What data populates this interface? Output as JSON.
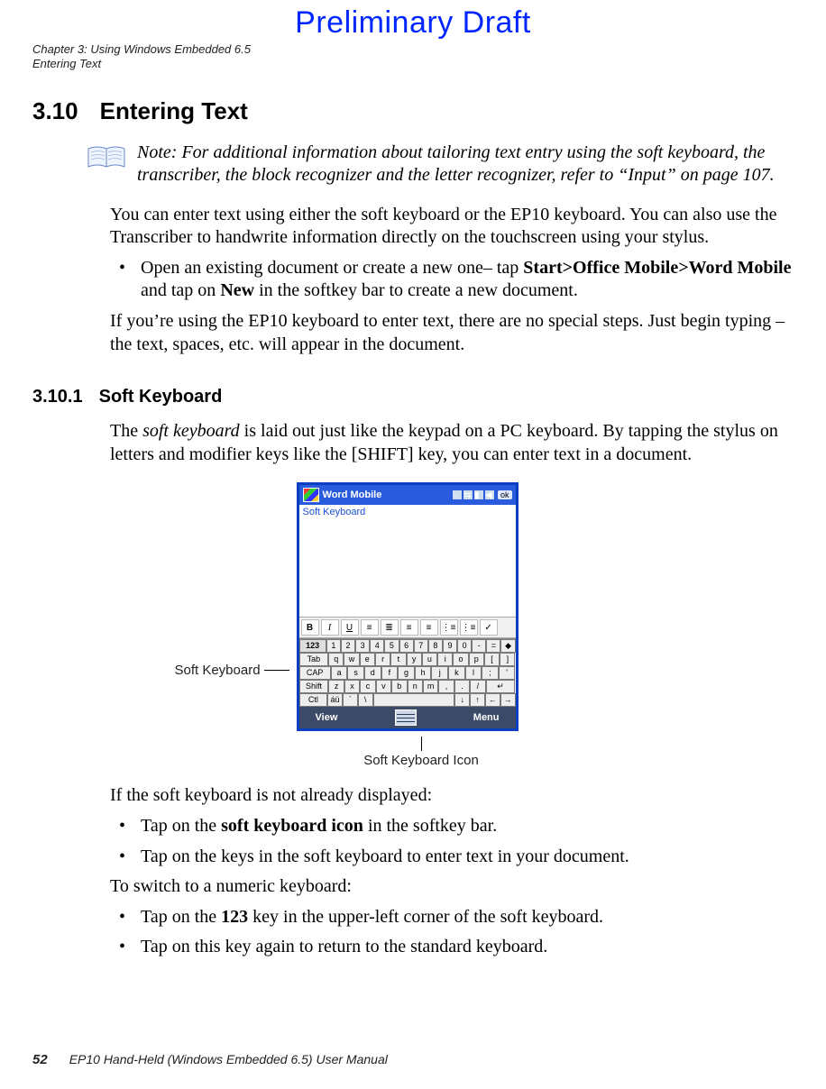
{
  "watermark": "Preliminary Draft",
  "runhead": {
    "l1": "Chapter 3: Using Windows Embedded 6.5",
    "l2": "Entering Text"
  },
  "section": {
    "num": "3.10",
    "title": "Entering Text"
  },
  "note": {
    "label": "Note:",
    "text": "For additional information about tailoring text entry using the soft keyboard, the transcriber, the block recognizer and the letter recognizer, refer to “Input” on page 107."
  },
  "p_intro": "You can enter text using either the soft keyboard or the EP10 keyboard. You can also use the Transcriber to handwrite information directly on the touchscreen using your stylus.",
  "li_open": {
    "pre": "Open an existing document or create a new one– tap ",
    "b1": "Start>Office Mobile>Word Mobile",
    "mid": " and tap on ",
    "b2": "New",
    "post": " in the softkey bar to create a new document."
  },
  "p_after": "If you’re using the EP10 keyboard to enter text, there are no special steps. Just begin typing – the text, spaces, etc. will appear in the document.",
  "subsection": {
    "num": "3.10.1",
    "title": "Soft Keyboard"
  },
  "p_soft": {
    "pre": "The ",
    "ital": "soft keyboard",
    "post": " is laid out just like the keypad on a PC keyboard. By tapping the stylus on letters and modifier keys like the [SHIFT] key, you can enter text in a document."
  },
  "callouts": {
    "left": "Soft Keyboard",
    "bottom": "Soft Keyboard Icon"
  },
  "p_notdisplayed": "If the soft keyboard is not already displayed:",
  "li_icon": {
    "pre": "Tap on the ",
    "b": "soft keyboard icon",
    "post": " in the softkey bar."
  },
  "li_type": "Tap on the keys in the soft keyboard to enter text in your document.",
  "p_switch": "To switch to a numeric keyboard:",
  "li_123": {
    "pre": "Tap on the ",
    "b": "123",
    "post": " key in the upper-left corner of the soft keyboard."
  },
  "li_return": "Tap on this key again to return to the standard keyboard.",
  "footer": {
    "page": "52",
    "manual": "EP10 Hand-Held (Windows Embedded 6.5) User Manual"
  },
  "device": {
    "title": "Word Mobile",
    "doc_label": "Soft Keyboard",
    "ok": "ok",
    "menu_left": "View",
    "menu_right": "Menu",
    "toolbar": [
      "B",
      "I",
      "U",
      "≡",
      "≣",
      "≡",
      "≡",
      "⋮≡",
      "⋮≡",
      "✓"
    ],
    "rows": [
      [
        "123",
        "1",
        "2",
        "3",
        "4",
        "5",
        "6",
        "7",
        "8",
        "9",
        "0",
        "-",
        "=",
        "◆"
      ],
      [
        "Tab",
        "q",
        "w",
        "e",
        "r",
        "t",
        "y",
        "u",
        "i",
        "o",
        "p",
        "[",
        "]"
      ],
      [
        "CAP",
        "a",
        "s",
        "d",
        "f",
        "g",
        "h",
        "j",
        "k",
        "l",
        ";",
        "'"
      ],
      [
        "Shift",
        "z",
        "x",
        "c",
        "v",
        "b",
        "n",
        "m",
        ",",
        ".",
        "/",
        "↵"
      ],
      [
        "Ctl",
        "áü",
        "`",
        "\\",
        " ",
        "↓",
        "↑",
        "←",
        "→"
      ]
    ]
  }
}
